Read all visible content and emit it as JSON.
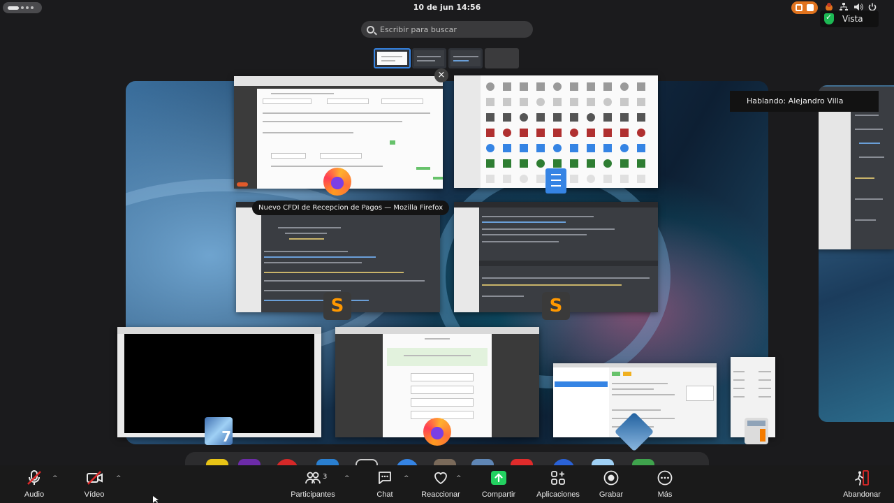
{
  "topbar": {
    "clock": "10 de jun  14:56",
    "view_label": "Vista",
    "icons": [
      "activities-icon",
      "zoom-share-indicator-icon",
      "tray-app-icon",
      "network-icon",
      "volume-icon",
      "power-icon",
      "shield-check-icon"
    ]
  },
  "overview": {
    "search_placeholder": "Escribir para buscar",
    "window_tooltip": "Nuevo CFDI de Recepcion de Pagos — Mozilla Firefox",
    "close_glyph": "×",
    "workspaces": 4,
    "active_workspace": 1
  },
  "meeting": {
    "speaking": "Hablando: Alejandro Villa"
  },
  "toolbar": {
    "audio": "Audio",
    "video": "Vídeo",
    "participants": "Participantes",
    "participants_count": "3",
    "chat": "Chat",
    "react": "Reaccionar",
    "share": "Compartir",
    "apps": "Aplicaciones",
    "record": "Grabar",
    "more": "Más",
    "leave": "Abandonar",
    "caret": "^"
  },
  "colors": {
    "accent_blue": "#3584e4",
    "share_green": "#23d160",
    "mute_red": "#e02828",
    "zoom_orange": "#e0731e"
  }
}
